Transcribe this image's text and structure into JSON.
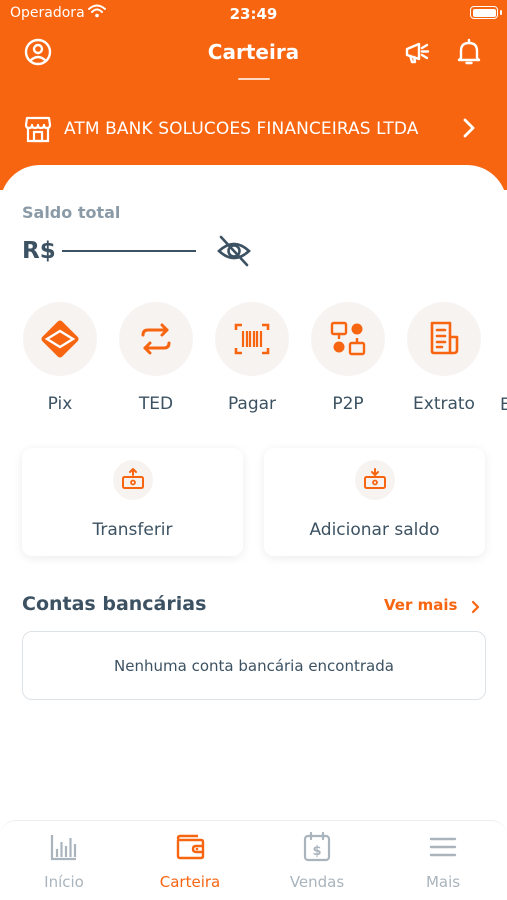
{
  "status_bar": {
    "carrier": "Operadora",
    "time": "23:49"
  },
  "header": {
    "title": "Carteira"
  },
  "company": {
    "name": "ATM BANK SOLUCOES FINANCEIRAS LTDA"
  },
  "balance": {
    "label": "Saldo total",
    "currency": "R$"
  },
  "quick_actions": [
    {
      "label": "Pix",
      "icon": "pix-icon"
    },
    {
      "label": "TED",
      "icon": "transfer-arrows-icon"
    },
    {
      "label": "Pagar",
      "icon": "barcode-icon"
    },
    {
      "label": "P2P",
      "icon": "p2p-icon"
    },
    {
      "label": "Extrato",
      "icon": "statement-icon"
    }
  ],
  "quick_actions_overflow": "E",
  "cards": [
    {
      "label": "Transferir",
      "icon": "send-money-icon"
    },
    {
      "label": "Adicionar saldo",
      "icon": "add-money-icon"
    }
  ],
  "bank_accounts": {
    "title": "Contas bancárias",
    "see_more": "Ver mais",
    "empty_text": "Nenhuma conta bancária encontrada"
  },
  "tabs": [
    {
      "label": "Início",
      "icon": "chart-icon",
      "active": false
    },
    {
      "label": "Carteira",
      "icon": "wallet-icon",
      "active": true
    },
    {
      "label": "Vendas",
      "icon": "calendar-dollar-icon",
      "active": false
    },
    {
      "label": "Mais",
      "icon": "menu-icon",
      "active": false
    }
  ],
  "colors": {
    "accent": "#f86511",
    "text": "#3c5262",
    "muted": "#a9b4bd"
  }
}
